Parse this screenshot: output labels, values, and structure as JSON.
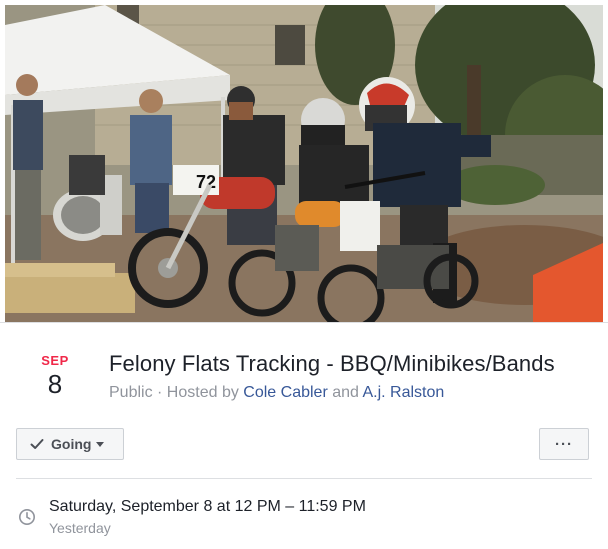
{
  "event": {
    "month": "SEP",
    "day": "8",
    "title": "Felony Flats Tracking - BBQ/Minibikes/Bands",
    "privacy": "Public",
    "hosted_by_prefix": " · Hosted by ",
    "host_1": "Cole Cabler",
    "and_text": " and ",
    "host_2": "A.j. Ralston"
  },
  "actions": {
    "going_label": "Going",
    "more_label": "···"
  },
  "schedule": {
    "datetime": "Saturday, September 8 at 12 PM – 11:59 PM",
    "relative": "Yesterday"
  },
  "cover_photo": {
    "bike_number": "72",
    "accent_color": "#c0392b",
    "tent_color": "#f2f2f0"
  },
  "colors": {
    "month_red": "#f02849",
    "link_blue": "#385898",
    "muted_gray": "#90949c"
  }
}
